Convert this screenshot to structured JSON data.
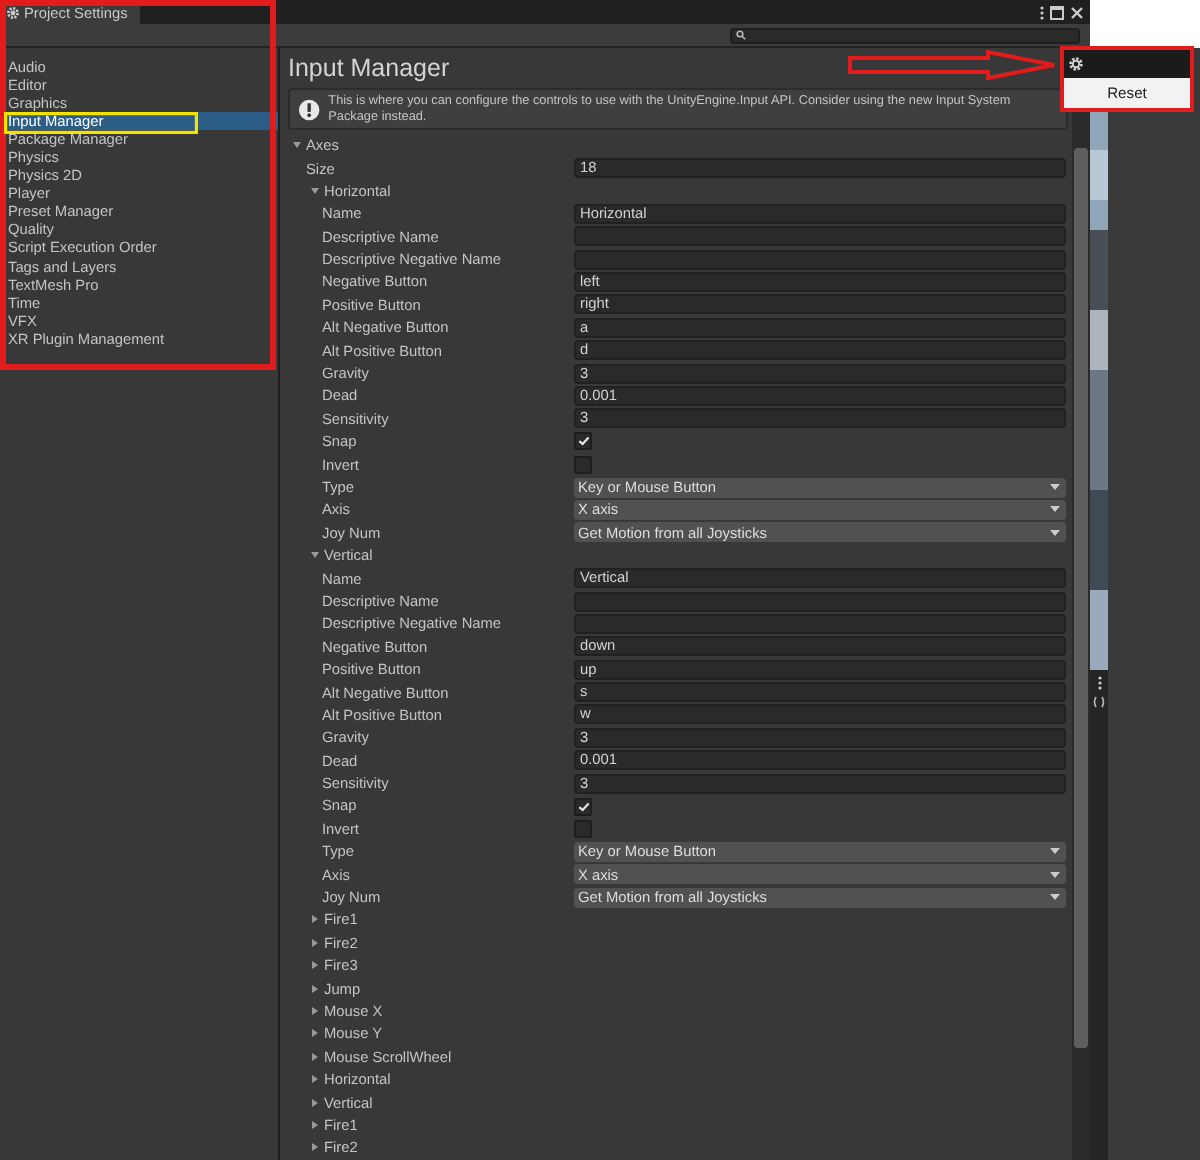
{
  "window": {
    "title": "Project Settings"
  },
  "sidebar": {
    "items": [
      {
        "label": "Audio",
        "selected": false
      },
      {
        "label": "Editor",
        "selected": false
      },
      {
        "label": "Graphics",
        "selected": false
      },
      {
        "label": "Input Manager",
        "selected": true
      },
      {
        "label": "Package Manager",
        "selected": false
      },
      {
        "label": "Physics",
        "selected": false
      },
      {
        "label": "Physics 2D",
        "selected": false
      },
      {
        "label": "Player",
        "selected": false
      },
      {
        "label": "Preset Manager",
        "selected": false
      },
      {
        "label": "Quality",
        "selected": false
      },
      {
        "label": "Script Execution Order",
        "selected": false
      },
      {
        "label": "Tags and Layers",
        "selected": false
      },
      {
        "label": "TextMesh Pro",
        "selected": false
      },
      {
        "label": "Time",
        "selected": false
      },
      {
        "label": "VFX",
        "selected": false
      },
      {
        "label": "XR Plugin Management",
        "selected": false
      }
    ]
  },
  "inspector": {
    "title": "Input Manager",
    "help": "This is where you can configure the controls to use with the UnityEngine.Input API. Consider using the new Input System Package instead.",
    "axes": {
      "label": "Axes",
      "expanded": true,
      "size_label": "Size",
      "size": "18",
      "items": [
        {
          "name": "Horizontal",
          "expanded": true,
          "fields": [
            {
              "label": "Name",
              "kind": "text",
              "value": "Horizontal"
            },
            {
              "label": "Descriptive Name",
              "kind": "text"
            },
            {
              "label": "Descriptive Negative Name",
              "kind": "text"
            },
            {
              "label": "Negative Button",
              "kind": "text",
              "value": "left"
            },
            {
              "label": "Positive Button",
              "kind": "text",
              "value": "right"
            },
            {
              "label": "Alt Negative Button",
              "kind": "text",
              "value": "a"
            },
            {
              "label": "Alt Positive Button",
              "kind": "text",
              "value": "d"
            },
            {
              "label": "Gravity",
              "kind": "text",
              "value": "3"
            },
            {
              "label": "Dead",
              "kind": "text",
              "value": "0.001"
            },
            {
              "label": "Sensitivity",
              "kind": "text",
              "value": "3"
            },
            {
              "label": "Snap",
              "kind": "checkbox",
              "checked": true
            },
            {
              "label": "Invert",
              "kind": "checkbox",
              "checked": false
            },
            {
              "label": "Type",
              "kind": "dropdown",
              "value": "Key or Mouse Button"
            },
            {
              "label": "Axis",
              "kind": "dropdown",
              "value": "X axis"
            },
            {
              "label": "Joy Num",
              "kind": "dropdown",
              "value": "Get Motion from all Joysticks"
            }
          ]
        },
        {
          "name": "Vertical",
          "expanded": true,
          "fields": [
            {
              "label": "Name",
              "kind": "text",
              "value": "Vertical"
            },
            {
              "label": "Descriptive Name",
              "kind": "text"
            },
            {
              "label": "Descriptive Negative Name",
              "kind": "text"
            },
            {
              "label": "Negative Button",
              "kind": "text",
              "value": "down"
            },
            {
              "label": "Positive Button",
              "kind": "text",
              "value": "up"
            },
            {
              "label": "Alt Negative Button",
              "kind": "text",
              "value": "s"
            },
            {
              "label": "Alt Positive Button",
              "kind": "text",
              "value": "w"
            },
            {
              "label": "Gravity",
              "kind": "text",
              "value": "3"
            },
            {
              "label": "Dead",
              "kind": "text",
              "value": "0.001"
            },
            {
              "label": "Sensitivity",
              "kind": "text",
              "value": "3"
            },
            {
              "label": "Snap",
              "kind": "checkbox",
              "checked": true
            },
            {
              "label": "Invert",
              "kind": "checkbox",
              "checked": false
            },
            {
              "label": "Type",
              "kind": "dropdown",
              "value": "Key or Mouse Button"
            },
            {
              "label": "Axis",
              "kind": "dropdown",
              "value": "X axis"
            },
            {
              "label": "Joy Num",
              "kind": "dropdown",
              "value": "Get Motion from all Joysticks"
            }
          ]
        },
        {
          "name": "Fire1",
          "expanded": false
        },
        {
          "name": "Fire2",
          "expanded": false
        },
        {
          "name": "Fire3",
          "expanded": false
        },
        {
          "name": "Jump",
          "expanded": false
        },
        {
          "name": "Mouse X",
          "expanded": false
        },
        {
          "name": "Mouse Y",
          "expanded": false
        },
        {
          "name": "Mouse ScrollWheel",
          "expanded": false
        },
        {
          "name": "Horizontal",
          "expanded": false
        },
        {
          "name": "Vertical",
          "expanded": false
        },
        {
          "name": "Fire1",
          "expanded": false
        },
        {
          "name": "Fire2",
          "expanded": false
        }
      ]
    }
  },
  "popup_menu": {
    "items": [
      "Reset"
    ]
  }
}
